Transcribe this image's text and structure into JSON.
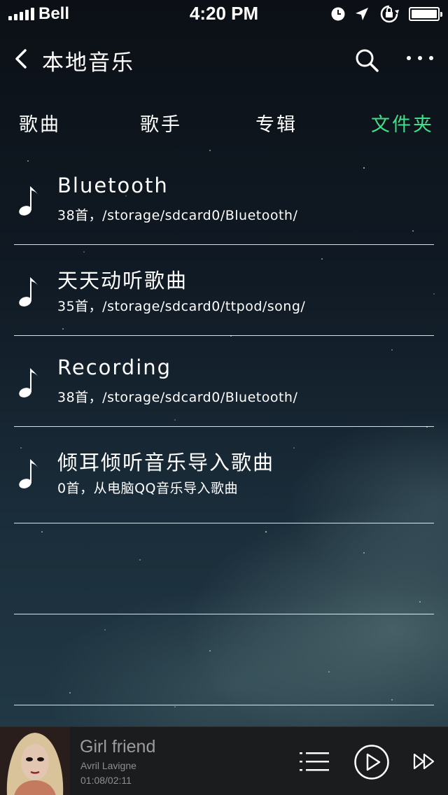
{
  "status_bar": {
    "carrier": "Bell",
    "time": "4:20 PM",
    "icons": [
      "signal-icon",
      "clock-icon",
      "location-arrow-icon",
      "rotation-lock-icon",
      "battery-icon"
    ]
  },
  "nav": {
    "title": "本地音乐",
    "icons": [
      "back-chevron-icon",
      "search-icon",
      "more-dots-icon"
    ]
  },
  "tabs": [
    {
      "label": "歌曲",
      "active": false
    },
    {
      "label": "歌手",
      "active": false
    },
    {
      "label": "专辑",
      "active": false
    },
    {
      "label": "文件夹",
      "active": true
    }
  ],
  "folders": [
    {
      "name": "Bluetooth",
      "detail": "38首，/storage/sdcard0/Bluetooth/",
      "icon": "music-note-icon"
    },
    {
      "name": "天天动听歌曲",
      "detail": "35首，/storage/sdcard0/ttpod/song/",
      "icon": "music-note-icon"
    },
    {
      "name": "Recording",
      "detail": "38首，/storage/sdcard0/Bluetooth/",
      "icon": "music-note-icon"
    },
    {
      "name": "倾耳倾听音乐导入歌曲",
      "detail": "0首，从电脑QQ音乐导入歌曲",
      "icon": "music-note-icon"
    }
  ],
  "player": {
    "song": "Girl friend",
    "artist": "Avril Lavigne",
    "time": "01:08/02:11",
    "icons": [
      "album-art",
      "playlist-icon",
      "play-icon",
      "next-icon"
    ]
  },
  "colors": {
    "accent": "#3fe08a",
    "text": "#ffffff",
    "player_bg": "#1b1c1e"
  }
}
